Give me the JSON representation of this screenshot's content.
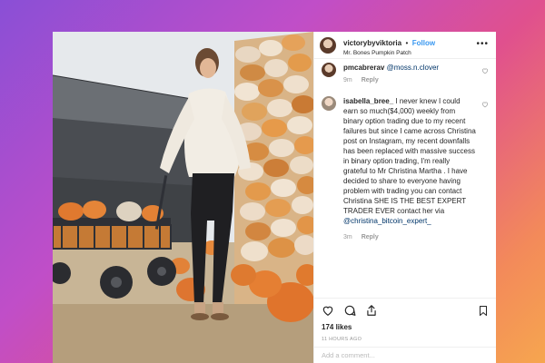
{
  "post": {
    "username": "victorybyviktoria",
    "separator": "•",
    "follow_label": "Follow",
    "location": "Mr. Bones Pumpkin Patch",
    "more_label": "•••"
  },
  "comments": [
    {
      "username": "pmcabrerav",
      "mention": "@moss.n.clover",
      "time": "9m",
      "reply_label": "Reply"
    },
    {
      "username": "isabella_bree_",
      "text": " I never knew I could earn so much($4,000) weekly from binary option trading due to my recent failures but since I came across Christina post on Instagram, my recent downfalls has been replaced with massive success in binary option trading, I'm really grateful to Mr Christina Martha . I have decided to share to everyone having problem with trading you can contact Christina SHE IS THE BEST EXPERT TRADER EVER contact her via ",
      "mention": "@christina_bitcoin_expert_",
      "time": "3m",
      "reply_label": "Reply"
    }
  ],
  "likes": "174 likes",
  "posted_ago": "11 HOURS AGO",
  "add_comment_placeholder": "Add a comment...",
  "icons": {
    "heart": "heart-icon",
    "comment": "comment-icon",
    "share": "share-icon",
    "bookmark": "bookmark-icon",
    "more": "more-icon"
  },
  "colors": {
    "link_blue": "#3897f0",
    "text": "#262626",
    "muted": "#999999"
  }
}
